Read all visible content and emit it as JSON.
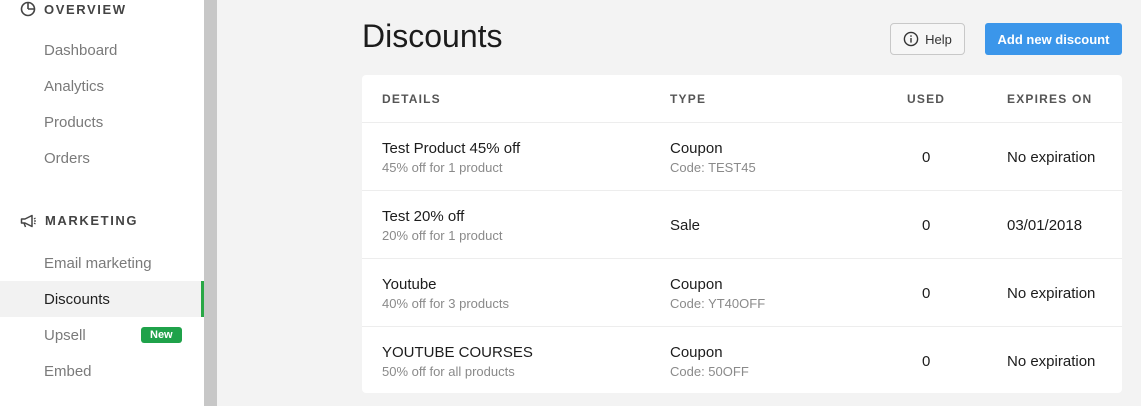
{
  "sidebar": {
    "overview_heading": "OVERVIEW",
    "overview_items": [
      "Dashboard",
      "Analytics",
      "Products",
      "Orders"
    ],
    "marketing_heading": "MARKETING",
    "marketing_items": [
      "Email marketing",
      "Discounts",
      "Upsell",
      "Embed"
    ],
    "active_item": "Discounts",
    "upsell_badge": "New"
  },
  "header": {
    "title": "Discounts",
    "help_label": "Help",
    "add_label": "Add new discount"
  },
  "table": {
    "columns": [
      "DETAILS",
      "TYPE",
      "USED",
      "EXPIRES ON"
    ],
    "rows": [
      {
        "name": "Test Product 45% off",
        "desc": "45% off for 1 product",
        "type": "Coupon",
        "code": "Code: TEST45",
        "used": "0",
        "expires": "No expiration"
      },
      {
        "name": "Test 20% off",
        "desc": "20% off for 1 product",
        "type": "Sale",
        "code": "",
        "used": "0",
        "expires": "03/01/2018"
      },
      {
        "name": "Youtube",
        "desc": "40% off for 3 products",
        "type": "Coupon",
        "code": "Code: YT40OFF",
        "used": "0",
        "expires": "No expiration"
      },
      {
        "name": "YOUTUBE COURSES",
        "desc": "50% off for all products",
        "type": "Coupon",
        "code": "Code: 50OFF",
        "used": "0",
        "expires": "No expiration"
      }
    ]
  },
  "colors": {
    "accent": "#3b96ea",
    "active_indicator": "#28a745",
    "badge": "#1fa24a"
  }
}
